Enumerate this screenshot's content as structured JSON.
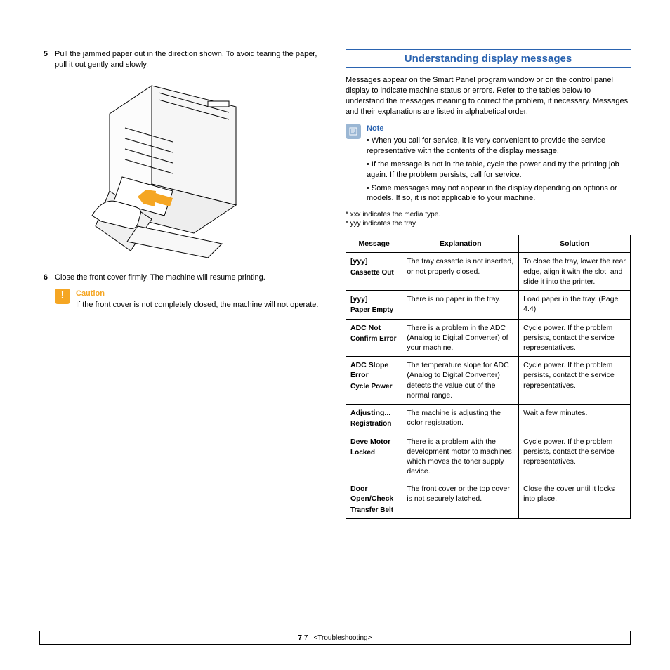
{
  "left": {
    "step5_num": "5",
    "step5_text": "Pull the jammed paper out in the direction shown. To avoid tearing the paper, pull it out gently and slowly.",
    "step6_num": "6",
    "step6_text": "Close the front cover firmly. The machine will resume printing.",
    "caution_title": "Caution",
    "caution_text": "If the front cover is not completely closed, the machine will not operate."
  },
  "right": {
    "section_title": "Understanding display messages",
    "intro": "Messages appear on the Smart Panel program window or on the control panel display to indicate machine status or errors. Refer to the tables below to understand the messages meaning to correct the problem, if necessary. Messages and their explanations are listed in alphabetical order.",
    "note_title": "Note",
    "note_b1": "• When you call for service, it is very convenient to provide the service representative with the contents of the display message.",
    "note_b2": "• If the message is not in the table, cycle the power and try the printing job again. If the problem persists, call for service.",
    "note_b3": "• Some messages may not appear in the display depending on options or models. If so, it is not applicable to your machine.",
    "foot1": "* xxx indicates the media type.",
    "foot2": "* yyy indicates the tray.",
    "th_msg": "Message",
    "th_exp": "Explanation",
    "th_sol": "Solution",
    "rows": [
      {
        "msg": "[yyy]",
        "msg2": "Cassette Out",
        "exp": "The tray cassette is not inserted, or not properly closed.",
        "sol": "To close the tray, lower the rear edge, align it with the slot, and slide it into the printer."
      },
      {
        "msg": "[yyy]",
        "msg2": "Paper Empty",
        "exp": "There is no paper in the tray.",
        "sol": "Load paper in the tray. (Page 4.4)"
      },
      {
        "msg": "ADC Not",
        "msg2": "Confirm Error",
        "exp": "There is a problem in the ADC (Analog to Digital Converter) of your machine.",
        "sol": "Cycle power. If the problem persists, contact the service representatives."
      },
      {
        "msg": "ADC Slope Error",
        "msg2": "Cycle Power",
        "exp": "The temperature slope for ADC (Analog to Digital Converter) detects the value out of the normal range.",
        "sol": "Cycle power. If the problem persists, contact the service representatives."
      },
      {
        "msg": "Adjusting...",
        "msg2": "Registration",
        "exp": "The machine is adjusting the color registration.",
        "sol": "Wait a few minutes."
      },
      {
        "msg": "Deve Motor",
        "msg2": "Locked",
        "exp": "There is a problem with the development motor to machines which moves the toner supply device.",
        "sol": "Cycle power. If the problem persists, contact the service representatives."
      },
      {
        "msg": "Door Open/Check",
        "msg2": "Transfer Belt",
        "exp": "The front cover or the top cover is not securely latched.",
        "sol": "Close the cover until it locks into place."
      }
    ]
  },
  "footer": {
    "page_bold": "7",
    "page_rest": ".7",
    "chapter": "<Troubleshooting>"
  }
}
